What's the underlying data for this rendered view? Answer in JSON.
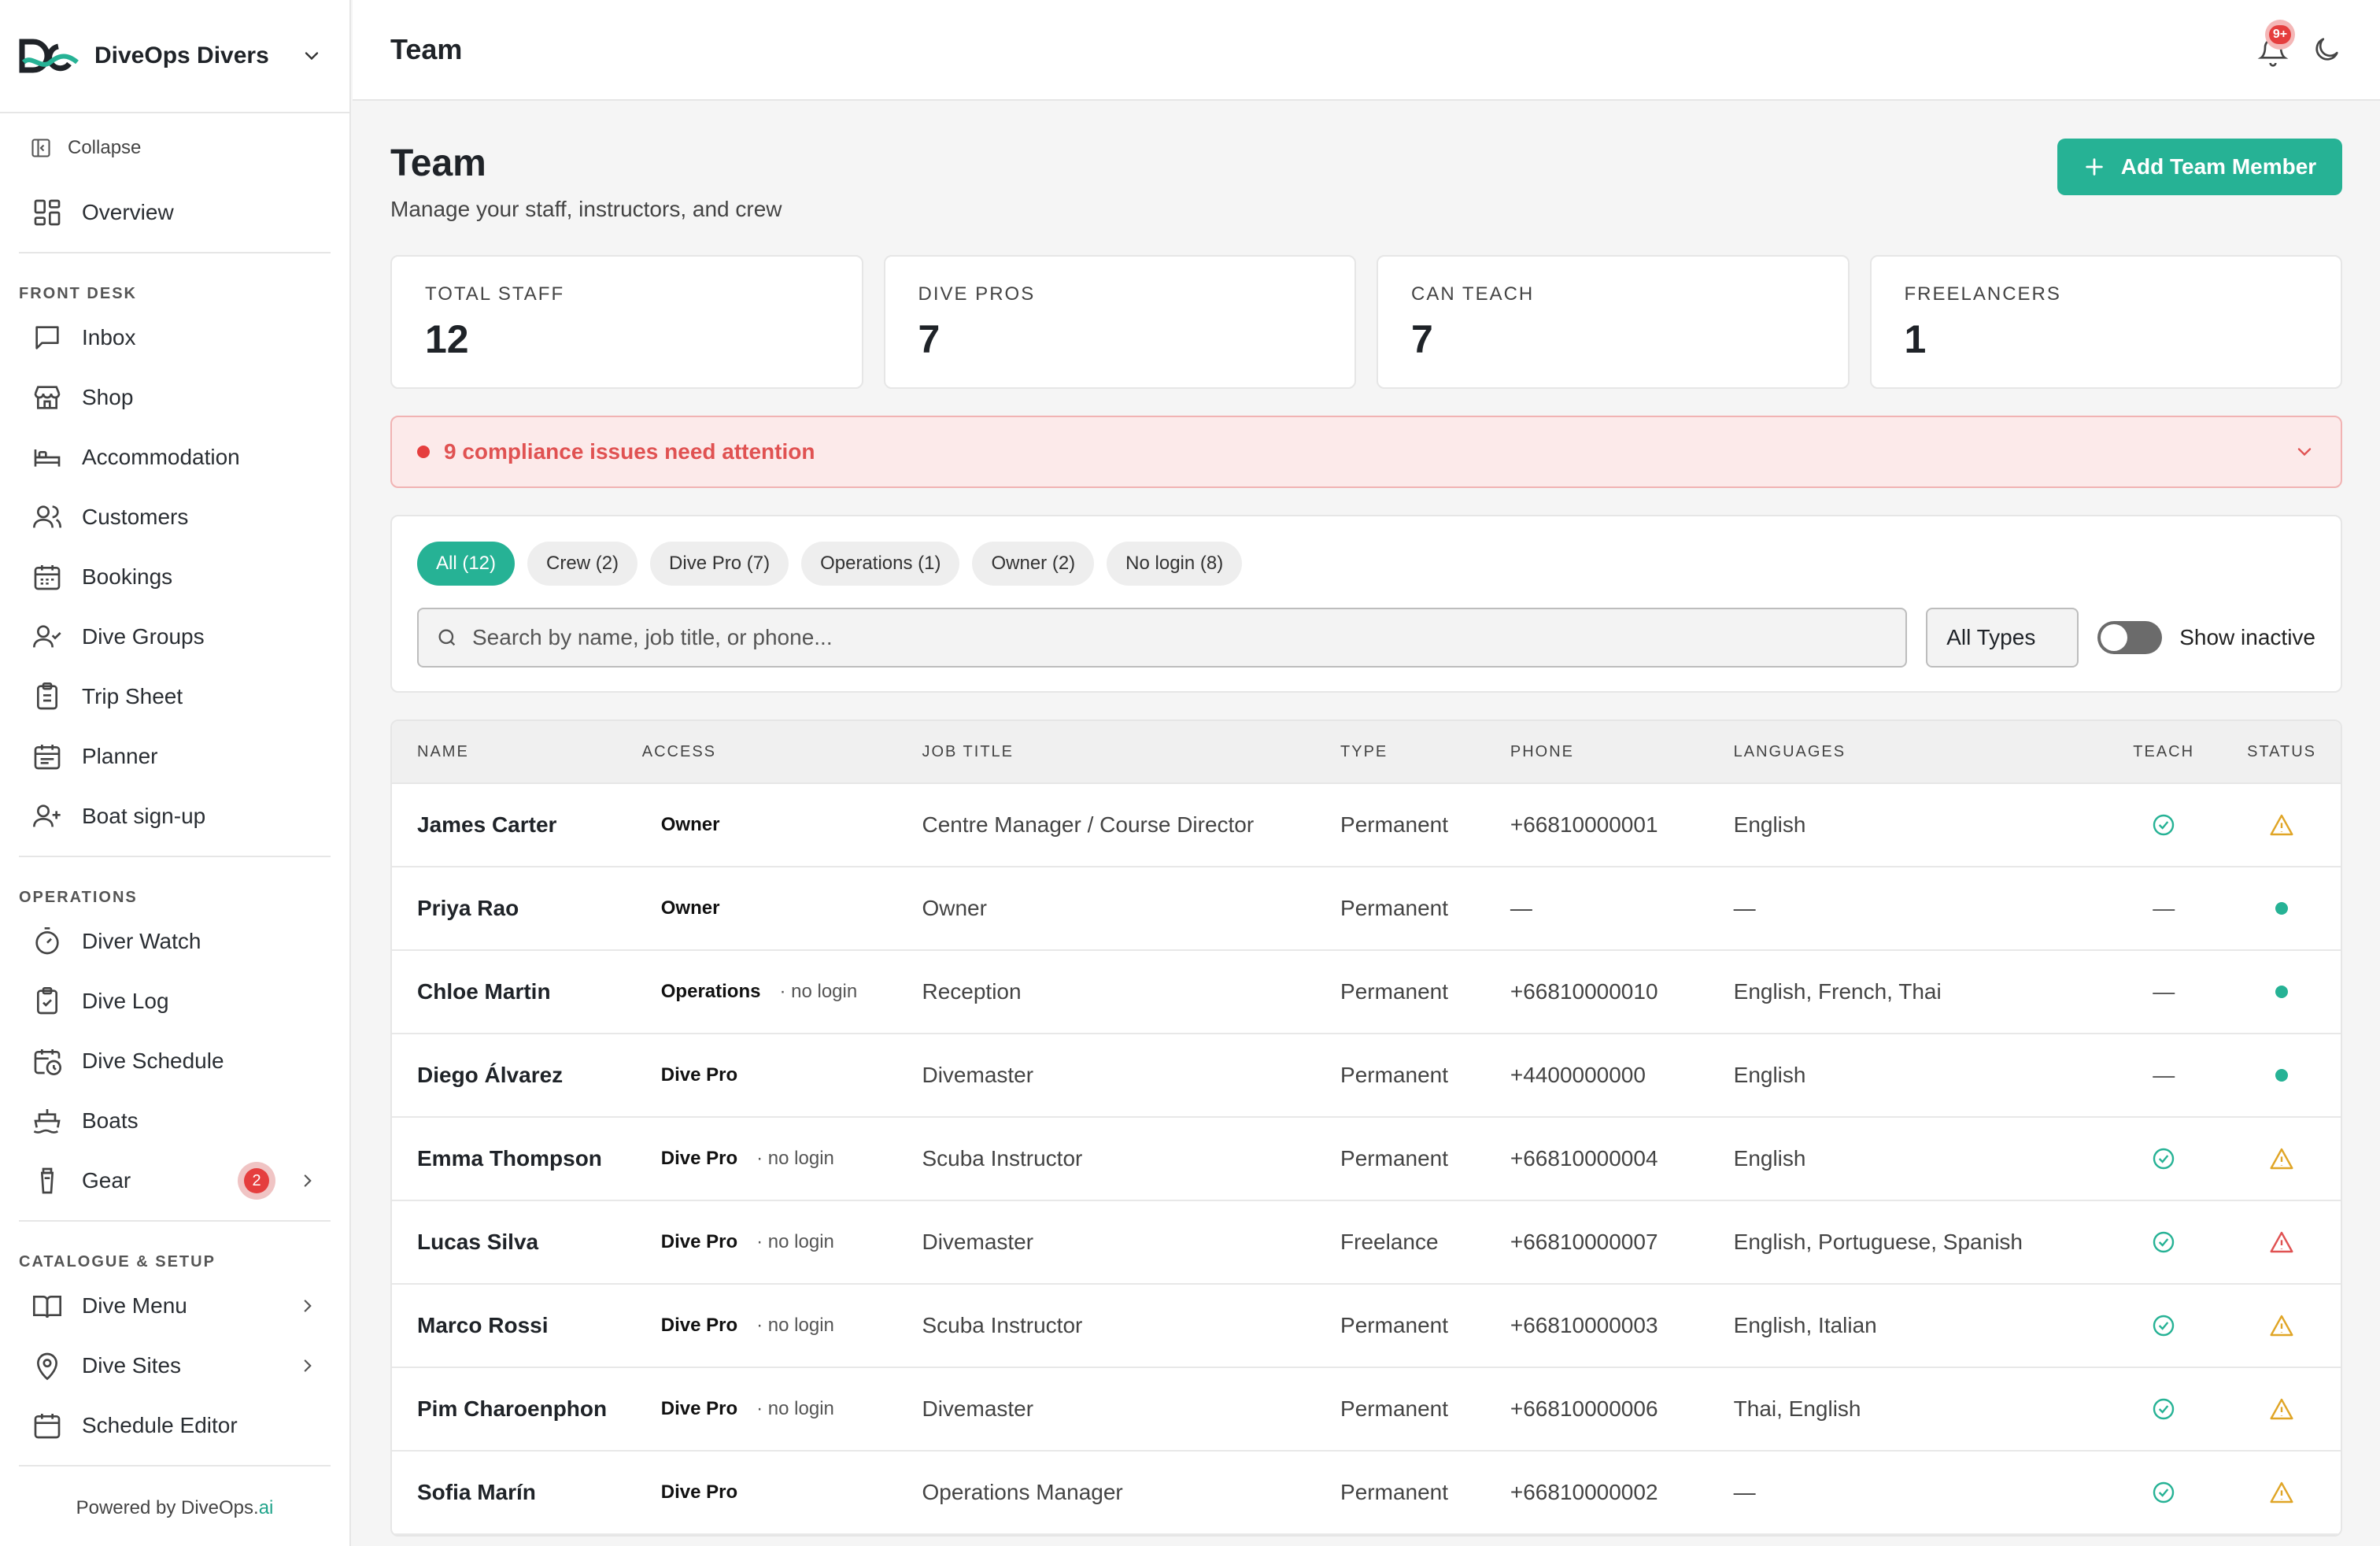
{
  "brand": {
    "name": "DiveOps Divers"
  },
  "sidebar": {
    "collapse_label": "Collapse",
    "overview_label": "Overview",
    "sections": [
      {
        "title": "FRONT DESK",
        "items": [
          {
            "label": "Inbox",
            "icon": "inbox-icon"
          },
          {
            "label": "Shop",
            "icon": "shop-icon"
          },
          {
            "label": "Accommodation",
            "icon": "bed-icon"
          },
          {
            "label": "Customers",
            "icon": "users-icon"
          },
          {
            "label": "Bookings",
            "icon": "calendar-icon"
          },
          {
            "label": "Dive Groups",
            "icon": "user-check-icon"
          },
          {
            "label": "Trip Sheet",
            "icon": "clipboard-icon"
          },
          {
            "label": "Planner",
            "icon": "calendar-range-icon"
          },
          {
            "label": "Boat sign-up",
            "icon": "user-plus-icon"
          }
        ]
      },
      {
        "title": "OPERATIONS",
        "items": [
          {
            "label": "Diver Watch",
            "icon": "timer-icon"
          },
          {
            "label": "Dive Log",
            "icon": "clipboard-check-icon"
          },
          {
            "label": "Dive Schedule",
            "icon": "calendar-clock-icon"
          },
          {
            "label": "Boats",
            "icon": "ship-icon"
          },
          {
            "label": "Gear",
            "icon": "tank-icon",
            "badge": "2"
          }
        ]
      },
      {
        "title": "CATALOGUE & SETUP",
        "items": [
          {
            "label": "Dive Menu",
            "icon": "book-icon"
          },
          {
            "label": "Dive Sites",
            "icon": "map-pin-icon"
          },
          {
            "label": "Schedule Editor",
            "icon": "calendar-icon"
          }
        ]
      }
    ],
    "powered_prefix": "Powered by DiveOps.",
    "powered_suffix": "ai"
  },
  "topbar": {
    "title": "Team",
    "notification_badge": "9+"
  },
  "page": {
    "title": "Team",
    "subtitle": "Manage your staff, instructors, and crew",
    "add_button": "Add Team Member"
  },
  "stats": [
    {
      "label": "TOTAL STAFF",
      "value": "12"
    },
    {
      "label": "DIVE PROS",
      "value": "7"
    },
    {
      "label": "CAN TEACH",
      "value": "7"
    },
    {
      "label": "FREELANCERS",
      "value": "1"
    }
  ],
  "alert": {
    "text": "9 compliance issues need attention",
    "color": "#e05252"
  },
  "filters": {
    "chips": [
      "All (12)",
      "Crew (2)",
      "Dive Pro (7)",
      "Operations (1)",
      "Owner (2)",
      "No login (8)"
    ],
    "active_chip": 0,
    "search_placeholder": "Search by name, job title, or phone...",
    "type_select": "All Types",
    "show_inactive_label": "Show inactive"
  },
  "table": {
    "columns": [
      "NAME",
      "ACCESS",
      "JOB TITLE",
      "TYPE",
      "PHONE",
      "LANGUAGES",
      "TEACH",
      "STATUS"
    ],
    "rows": [
      {
        "name": "James Carter",
        "access": "Owner",
        "note": "",
        "job": "Centre Manager / Course Director",
        "type": "Permanent",
        "phone": "+66810000001",
        "languages": "English",
        "teach": "check",
        "status": "warning"
      },
      {
        "name": "Priya Rao",
        "access": "Owner",
        "note": "",
        "job": "Owner",
        "type": "Permanent",
        "phone": "—",
        "languages": "—",
        "teach": "dash",
        "status": "active"
      },
      {
        "name": "Chloe Martin",
        "access": "Operations",
        "note": "· no login",
        "job": "Reception",
        "type": "Permanent",
        "phone": "+66810000010",
        "languages": "English, French, Thai",
        "teach": "dash",
        "status": "active"
      },
      {
        "name": "Diego Álvarez",
        "access": "Dive Pro",
        "note": "",
        "job": "Divemaster",
        "type": "Permanent",
        "phone": "+4400000000",
        "languages": "English",
        "teach": "dash",
        "status": "active"
      },
      {
        "name": "Emma Thompson",
        "access": "Dive Pro",
        "note": "· no login",
        "job": "Scuba Instructor",
        "type": "Permanent",
        "phone": "+66810000004",
        "languages": "English",
        "teach": "check",
        "status": "warning"
      },
      {
        "name": "Lucas Silva",
        "access": "Dive Pro",
        "note": "· no login",
        "job": "Divemaster",
        "type": "Freelance",
        "phone": "+66810000007",
        "languages": "English, Portuguese, Spanish",
        "teach": "check",
        "status": "error"
      },
      {
        "name": "Marco Rossi",
        "access": "Dive Pro",
        "note": "· no login",
        "job": "Scuba Instructor",
        "type": "Permanent",
        "phone": "+66810000003",
        "languages": "English, Italian",
        "teach": "check",
        "status": "warning"
      },
      {
        "name": "Pim Charoenphon",
        "access": "Dive Pro",
        "note": "· no login",
        "job": "Divemaster",
        "type": "Permanent",
        "phone": "+66810000006",
        "languages": "Thai, English",
        "teach": "check",
        "status": "warning"
      },
      {
        "name": "Sofia Marín",
        "access": "Dive Pro",
        "note": "",
        "job": "Operations Manager",
        "type": "Permanent",
        "phone": "+66810000002",
        "languages": "—",
        "teach": "check",
        "status": "warning"
      }
    ]
  },
  "colors": {
    "accent": "#26b295",
    "danger": "#e53e3e",
    "warning": "#e0a526"
  }
}
